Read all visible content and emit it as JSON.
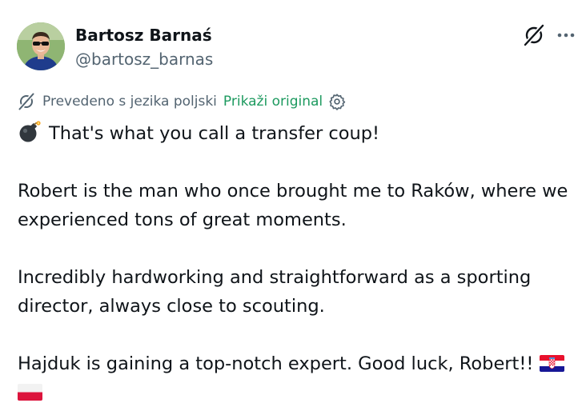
{
  "author": {
    "name": "Bartosz Barnaś",
    "handle": "@bartosz_barnas"
  },
  "icons": {
    "grok": "grok-icon",
    "more": "more-icon",
    "translate": "translate-icon",
    "settings": "gear-icon",
    "bomb": "bomb-emoji",
    "flag_croatia": "croatia-flag",
    "flag_poland": "poland-flag"
  },
  "translation": {
    "notice": "Prevedeno s jezika poljski",
    "show_original": "Prikaži original"
  },
  "post": {
    "line1": "That's what you call a transfer coup!",
    "para2": "Robert is the man who once brought me to Raków, where we experienced tons of great moments.",
    "para3": "Incredibly hardworking and straightforward as a sporting director, always close to scouting.",
    "para4": "Hajduk is gaining a top-notch expert. Good luck, Robert!!"
  },
  "colors": {
    "text": "#0f1419",
    "secondary": "#536471",
    "show_original": "#1d9a5f"
  }
}
